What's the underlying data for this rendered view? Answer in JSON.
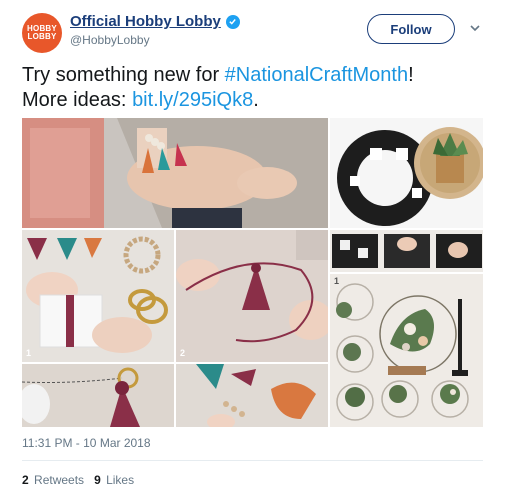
{
  "author": {
    "avatar_lines": [
      "HOBBY",
      "LOBBY"
    ],
    "display_name": "Official Hobby Lobby",
    "handle": "@HobbyLobby",
    "verified_icon": "verified-check-icon"
  },
  "follow_label": "Follow",
  "tweet": {
    "text_line1": "Try something new for ",
    "hashtag": "#NationalCraftMonth",
    "text_line1_end": "!",
    "text_line2": "More ideas: ",
    "link": "bit.ly/295iQk8",
    "text_line2_end": "."
  },
  "media": {
    "step_numbers": [
      "1",
      "2",
      "1"
    ]
  },
  "timestamp": "11:31 PM - 10 Mar 2018",
  "stats": {
    "retweets_count": "2",
    "retweets_label": "Retweets",
    "likes_count": "9",
    "likes_label": "Likes"
  },
  "colors": {
    "brand": "#e8572a",
    "name": "#1b3e7a",
    "link": "#1b95e0",
    "verified": "#1da1f2"
  }
}
